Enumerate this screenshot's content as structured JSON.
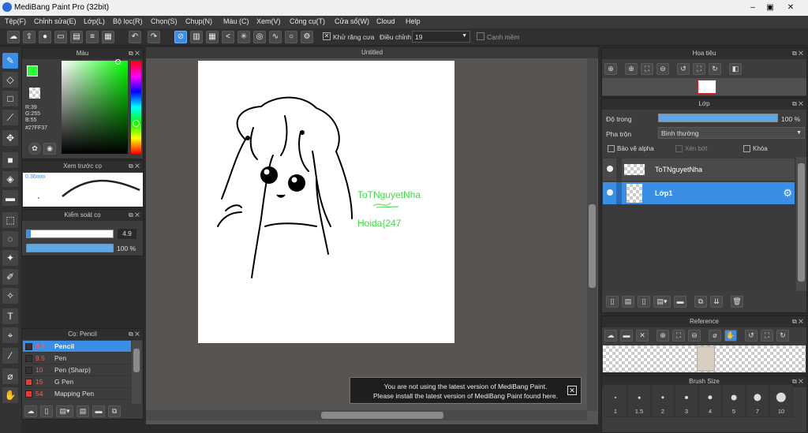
{
  "window": {
    "title": "MediBang Paint Pro (32bit)",
    "minimize": "–",
    "restore": "▣",
    "close": "✕"
  },
  "menu": [
    "Tệp(F)",
    "Chỉnh sửa(E)",
    "Lớp(L)",
    "Bộ lọc(R)",
    "Chọn(S)",
    "Chụp(N)",
    "Màu (C)",
    "Xem(V)",
    "Công cụ(T)",
    "Cửa sổ(W)",
    "Cloud",
    "Help"
  ],
  "toolbar": {
    "antialias_label": "Khử răng cưa",
    "adjust_label": "Điều chỉnh",
    "adjust_value": "19",
    "sharp_edge_label": "Cạnh mềm"
  },
  "color_panel": {
    "title": "Màu",
    "primary_color": "#27FF37",
    "r": "R:39",
    "g": "G:255",
    "b": "B:55",
    "hex": "#27FF37"
  },
  "brush_preview": {
    "title": "Xem trước cọ",
    "size_label": "0.36mm"
  },
  "brush_control": {
    "title": "Kiểm soát cọ",
    "size_value": "4.9",
    "opacity_value": "100 %",
    "opacity_fraction": 1.0
  },
  "brush_list": {
    "title": "Cọ: Pencil",
    "items": [
      {
        "size": "4.9",
        "name": "Pencil",
        "color": "#333333",
        "selected": true
      },
      {
        "size": "9.5",
        "name": "Pen",
        "color": "#333333",
        "selected": false
      },
      {
        "size": "10",
        "name": "Pen (Sharp)",
        "color": "#333333",
        "selected": false
      },
      {
        "size": "15",
        "name": "G Pen",
        "color": "#ff3030",
        "selected": false
      },
      {
        "size": "54",
        "name": "Mapping Pen",
        "color": "#ff3030",
        "selected": false
      }
    ]
  },
  "canvas": {
    "tab_title": "Untitled",
    "watermark_name": "ToTNguyetNha",
    "watermark_id": "Hoida{247"
  },
  "notice": {
    "line1": "You are not using the latest version of MediBang Paint.",
    "line2": "Please install the latest version of MediBang Paint found here.",
    "close": "✕"
  },
  "navigator": {
    "title": "Hoa tiêu"
  },
  "layers": {
    "title": "Lớp",
    "opacity_label": "Độ trong",
    "opacity_value": "100 %",
    "opacity_fraction": 1.0,
    "blend_label": "Pha trộn",
    "blend_value": "Bình thường",
    "protect_alpha": "Bảo vệ alpha",
    "clipping": "Xén bớt",
    "lock": "Khóa",
    "items": [
      {
        "name": "ToTNguyetNha",
        "selected": false
      },
      {
        "name": "Lớp1",
        "selected": true
      }
    ]
  },
  "reference": {
    "title": "Reference"
  },
  "brush_size": {
    "title": "Brush Size",
    "sizes": [
      "1",
      "1.5",
      "2",
      "3",
      "4",
      "5",
      "7",
      "10"
    ]
  },
  "colors": {
    "accent": "#3a8ee6",
    "panel_bg": "#3d3d3d",
    "canvas_bg": "#585452"
  }
}
